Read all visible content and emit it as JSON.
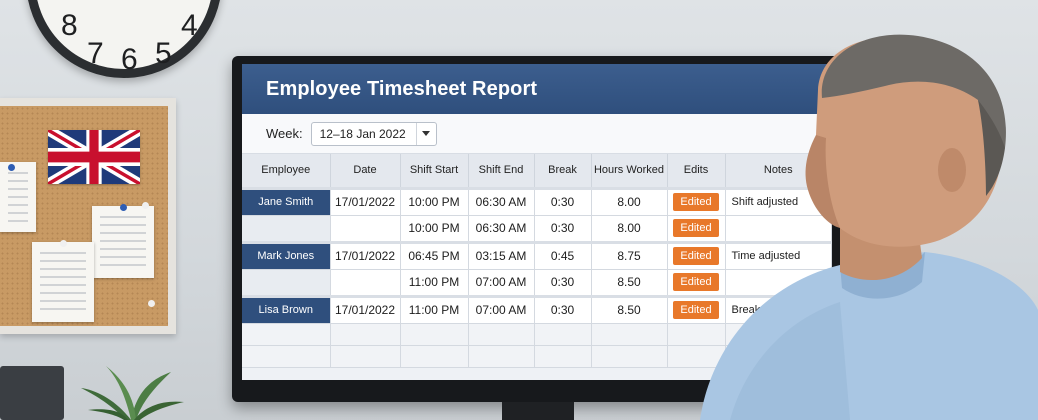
{
  "clock": {
    "numbers": [
      "8",
      "7",
      "6",
      "5",
      "4"
    ]
  },
  "app": {
    "title": "Employee Timesheet Report"
  },
  "week": {
    "label": "Week:",
    "value": "12–18 Jan 2022"
  },
  "columns": [
    "Employee",
    "Date",
    "Shift Start",
    "Shift End",
    "Break",
    "Hours Worked",
    "Edits",
    "Notes"
  ],
  "rows": [
    {
      "employee": "Jane Smith",
      "date": "17/01/2022",
      "start": "10:00 PM",
      "end": "06:30 AM",
      "break": "0:30",
      "hours": "8.00",
      "edit": "Edited",
      "notes": "Shift adjusted"
    },
    {
      "employee": "",
      "date": "",
      "start": "10:00 PM",
      "end": "06:30 AM",
      "break": "0:30",
      "hours": "8.00",
      "edit": "Edited",
      "notes": ""
    },
    {
      "employee": "Mark Jones",
      "date": "17/01/2022",
      "start": "06:45 PM",
      "end": "03:15 AM",
      "break": "0:45",
      "hours": "8.75",
      "edit": "Edited",
      "notes": "Time adjusted"
    },
    {
      "employee": "",
      "date": "",
      "start": "11:00 PM",
      "end": "07:00 AM",
      "break": "0:30",
      "hours": "8.50",
      "edit": "Edited",
      "notes": ""
    },
    {
      "employee": "Lisa Brown",
      "date": "17/01/2022",
      "start": "11:00 PM",
      "end": "07:00 AM",
      "break": "0:30",
      "hours": "8.50",
      "edit": "Edited",
      "notes": "Break time corrected"
    }
  ],
  "colors": {
    "header_blue": "#2f4f7d",
    "edited_orange": "#e8782a"
  }
}
